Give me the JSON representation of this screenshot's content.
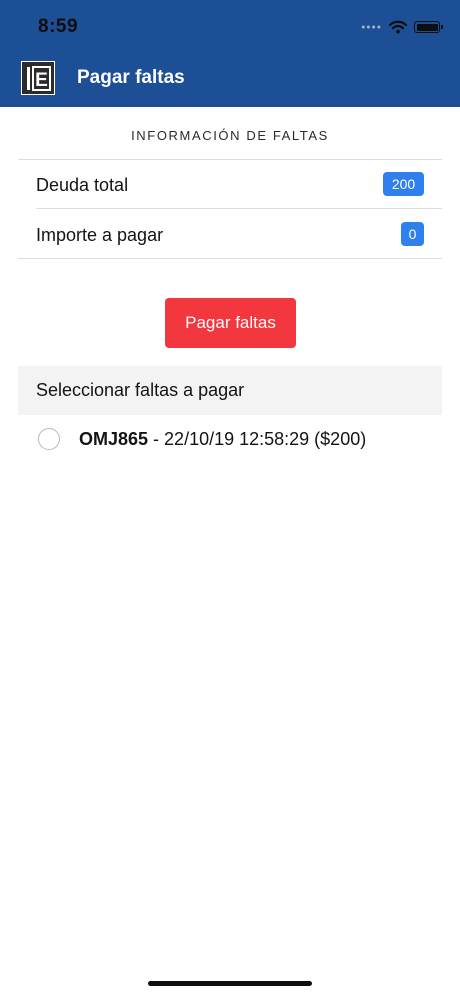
{
  "status_bar": {
    "time": "8:59",
    "icons": [
      "cellular-signal-icon",
      "wifi-icon",
      "battery-icon"
    ]
  },
  "header": {
    "logo_letter": "E",
    "logo_icon": "app-logo-icon",
    "title": "Pagar faltas"
  },
  "info": {
    "section_title": "INFORMACIÓN DE FALTAS",
    "rows": [
      {
        "label": "Deuda total",
        "value": "200"
      },
      {
        "label": "Importe a pagar",
        "value": "0"
      }
    ]
  },
  "pay_button": {
    "label": "Pagar faltas"
  },
  "select_section": {
    "title": "Seleccionar faltas a pagar",
    "items": [
      {
        "plate": "OMJ865",
        "details": " - 22/10/19 12:58:29 ($200)",
        "selected": false
      }
    ]
  },
  "colors": {
    "header_bg": "#1c4f96",
    "badge": "#2f80ed",
    "pay_button": "#f2373f",
    "section_bg": "#f3f3f3"
  }
}
